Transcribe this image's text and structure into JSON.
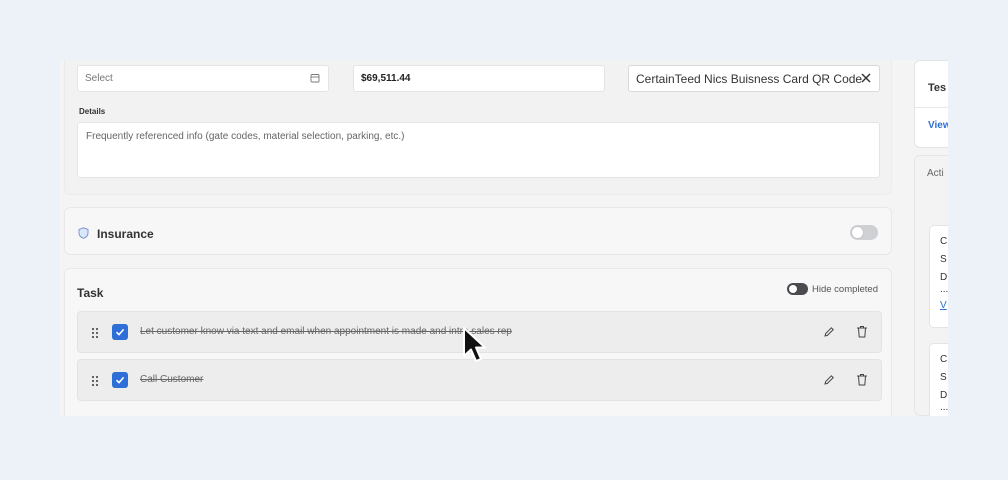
{
  "job": {
    "date_placeholder": "Select",
    "amount": "$69,511.44",
    "document": "CertainTeed Nics Buisness Card QR Code",
    "details_label": "Details",
    "details_placeholder": "Frequently referenced info (gate codes, material selection, parking, etc.)"
  },
  "insurance": {
    "title": "Insurance",
    "enabled": false
  },
  "tasks": {
    "title": "Task",
    "hide_completed_label": "Hide completed",
    "hide_completed": true,
    "items": [
      {
        "text": "Let customer know via text and email when appointment is made and intro sales rep",
        "completed": true
      },
      {
        "text": "Call Customer",
        "completed": true
      }
    ]
  },
  "sidebar": {
    "header_title": "Tes",
    "view_link": "View",
    "activity_tab": "Acti",
    "activity_cards": [
      {
        "lines": [
          "C",
          "S",
          "D",
          "..."
        ],
        "link": "V"
      },
      {
        "lines": [
          "C",
          "S",
          "D",
          "..."
        ]
      }
    ]
  },
  "colors": {
    "accent": "#2d6fd6",
    "background": "#edf2f9"
  }
}
